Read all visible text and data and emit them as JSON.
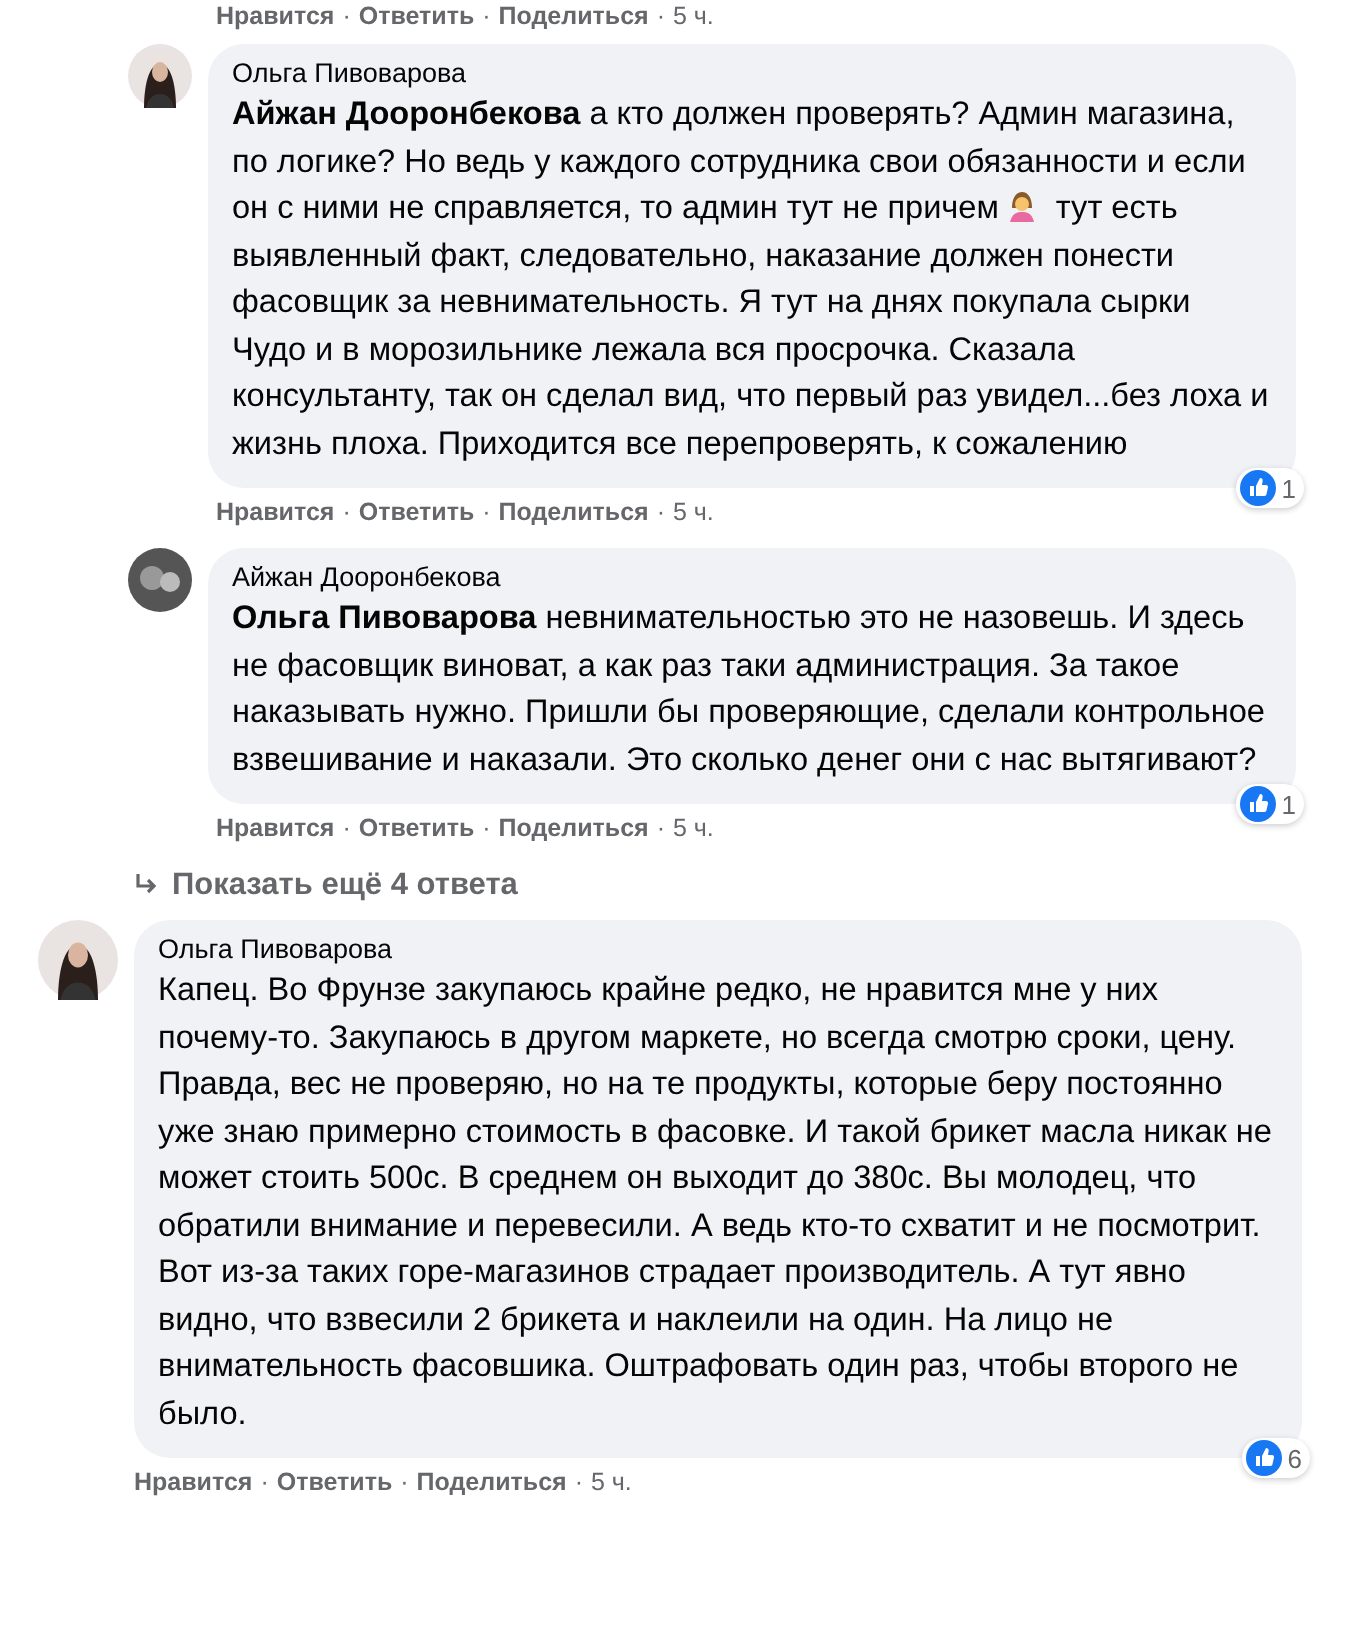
{
  "top_actions": {
    "like": "Нравится",
    "reply": "Ответить",
    "share": "Поделиться",
    "time": "5 ч.",
    "separator": "·"
  },
  "comments": [
    {
      "kind": "reply",
      "author": "Ольга Пивоварова",
      "segments": [
        {
          "kind": "text",
          "text": "**Айжан Дооронбекова** а кто должен проверять? Админ магазина, по логике? Но ведь у каждого сотрудника свои обязанности и если он с ними не справляется, то админ тут не причем"
        },
        {
          "kind": "emoji"
        },
        {
          "kind": "text",
          "text": "тут есть выявленный факт, следовательно, наказание должен понести фасовщик за невнимательность. Я тут на днях покупала сырки Чудо и в морозильнике лежала вся просрочка. Сказала консультанту, так он сделал вид, что первый раз увидел...без лоха и жизнь плоха. Приходится все перепроверять, к сожалению"
        }
      ],
      "reactions": "1",
      "like": "Нравится",
      "reply": "Ответить",
      "share": "Поделиться",
      "time": "5 ч.",
      "separator": "·"
    },
    {
      "kind": "reply",
      "author": "Айжан Дооронбекова",
      "segments": [
        {
          "kind": "text",
          "text": "**Ольга Пивоварова** невнимательностью это не назовешь. И здесь не фасовщик виноват, а как раз таки администрация. За такое наказывать нужно. Пришли бы проверяющие, сделали контрольное взвешивание и наказали. Это сколько денег они с нас вытягивают?"
        }
      ],
      "reactions": "1",
      "like": "Нравится",
      "reply": "Ответить",
      "share": "Поделиться",
      "time": "5 ч.",
      "separator": "·"
    },
    {
      "kind": "more",
      "text": "Показать ещё 4 ответа"
    },
    {
      "kind": "top",
      "author": "Ольга Пивоварова",
      "segments": [
        {
          "kind": "text",
          "text": "Капец. Во Фрунзе закупаюсь крайне редко, не нравится мне у них почему-то. Закупаюсь в другом маркете, но всегда смотрю сроки, цену. Правда, вес не проверяю, но на те продукты, которые беру постоянно уже знаю примерно стоимость в фасовке. И такой брикет масла никак не может стоить 500с. В среднем он выходит до 380с. Вы молодец, что обратили внимание и перевесили. А ведь кто-то схватит и не посмотрит. Вот из-за таких горе-магазинов страдает производитель. А тут явно видно, что взвесили 2 брикета и наклеили на один. На лицо не внимательность фасовшика. Оштрафовать один раз, чтобы второго не было."
        }
      ],
      "reactions": "6",
      "like": "Нравится",
      "reply": "Ответить",
      "share": "Поделиться",
      "time": "5 ч.",
      "separator": "·"
    }
  ]
}
